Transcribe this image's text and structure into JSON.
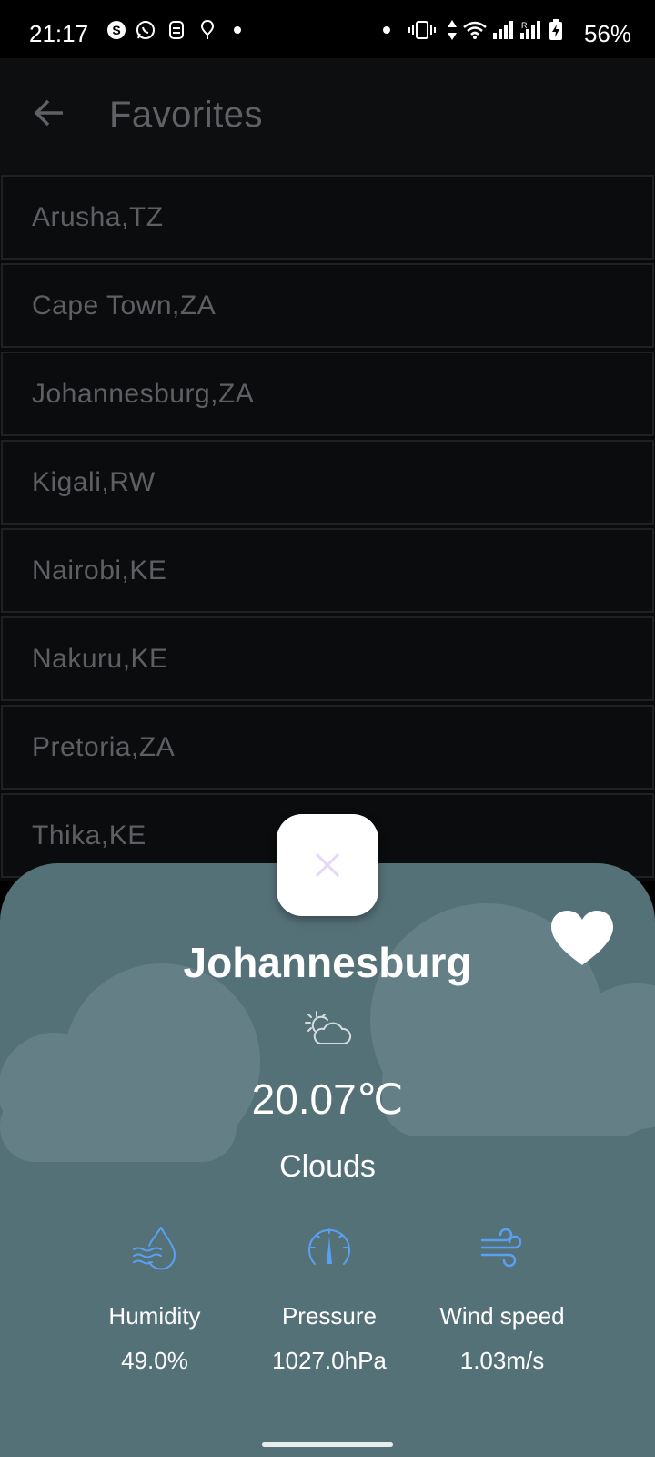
{
  "status_bar": {
    "time": "21:17",
    "battery": "56%",
    "left_icons": [
      "skype-icon",
      "whatsapp-icon",
      "snapchat-like-icon",
      "location-icon",
      "dot-icon"
    ],
    "right_icons": [
      "dot-icon",
      "vibrate-icon",
      "data-arrows-icon",
      "wifi-icon",
      "signal-icon",
      "signal-r-icon",
      "battery-charging-icon"
    ]
  },
  "app_bar": {
    "title": "Favorites",
    "back_icon": "arrow-left-icon"
  },
  "favorites": [
    "Arusha,TZ",
    "Cape Town,ZA",
    "Johannesburg,ZA",
    "Kigali,RW",
    "Nairobi,KE",
    "Nakuru,KE",
    "Pretoria,ZA",
    "Thika,KE"
  ],
  "weather_sheet": {
    "city": "Johannesburg",
    "temperature": "20.07℃",
    "description": "Clouds",
    "condition_icon": "partly-cloudy-icon",
    "favorite_icon": "heart-filled-icon",
    "metrics": [
      {
        "label": "Humidity",
        "value": "49.0%",
        "icon": "humidity-drop-icon"
      },
      {
        "label": "Pressure",
        "value": "1027.0hPa",
        "icon": "gauge-icon"
      },
      {
        "label": "Wind speed",
        "value": "1.03m/s",
        "icon": "wind-icon"
      }
    ],
    "close_icon": "close-icon"
  },
  "colors": {
    "sheet_bg": "#557178",
    "metric_icon": "#5aa0f2",
    "close_icon": "#e4d8f6",
    "list_text": "#5d5f63"
  }
}
